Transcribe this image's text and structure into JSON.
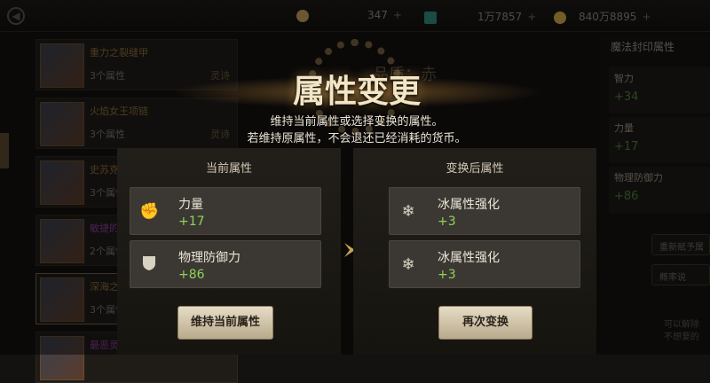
{
  "topbar": {
    "currency1_value": "347",
    "currency2_value": "1万7857",
    "currency3_value": "840万8895",
    "plus": "+"
  },
  "left_list": [
    {
      "name": "重力之裂缝甲",
      "count": "3个属性",
      "tag": "灵诗"
    },
    {
      "name": "火焰女王项链",
      "count": "3个属性",
      "tag": "灵诗"
    },
    {
      "name": "史苏克的三洲刑罚",
      "count": "3个属性",
      "tag": ""
    },
    {
      "name": "敏捷的黄金",
      "count": "2个属性",
      "tag": ""
    },
    {
      "name": "深海之源",
      "count": "3个属性",
      "tag": ""
    },
    {
      "name": "最恶灵甲长靴",
      "count": "",
      "tag": ""
    }
  ],
  "background_text": "品质：赤",
  "right_panel": {
    "title": "魔法封印属性",
    "items": [
      {
        "name": "智力",
        "value": "+34"
      },
      {
        "name": "力量",
        "value": "+17"
      },
      {
        "name": "物理防御力",
        "value": "+86"
      }
    ],
    "btn1": "重新赋予属",
    "btn2": "概率说",
    "footer": "可以解除\n不想要的"
  },
  "dialog": {
    "title": "属性变更",
    "desc_line1": "维持当前属性或选择变换的属性。",
    "desc_line2": "若维持原属性，不会退还已经消耗的货币。",
    "current": {
      "header": "当前属性",
      "stats": [
        {
          "icon": "fist-icon",
          "name": "力量",
          "value": "+17"
        },
        {
          "icon": "shield-icon",
          "name": "物理防御力",
          "value": "+86"
        }
      ],
      "button": "维持当前属性"
    },
    "changed": {
      "header": "变换后属性",
      "stats": [
        {
          "icon": "snowflake-icon",
          "name": "冰属性强化",
          "value": "+3"
        },
        {
          "icon": "snowflake-icon",
          "name": "冰属性强化",
          "value": "+3"
        }
      ],
      "button": "再次变换"
    }
  },
  "colors": {
    "accent_green": "#8fd25a",
    "gold": "#c9a35a"
  }
}
